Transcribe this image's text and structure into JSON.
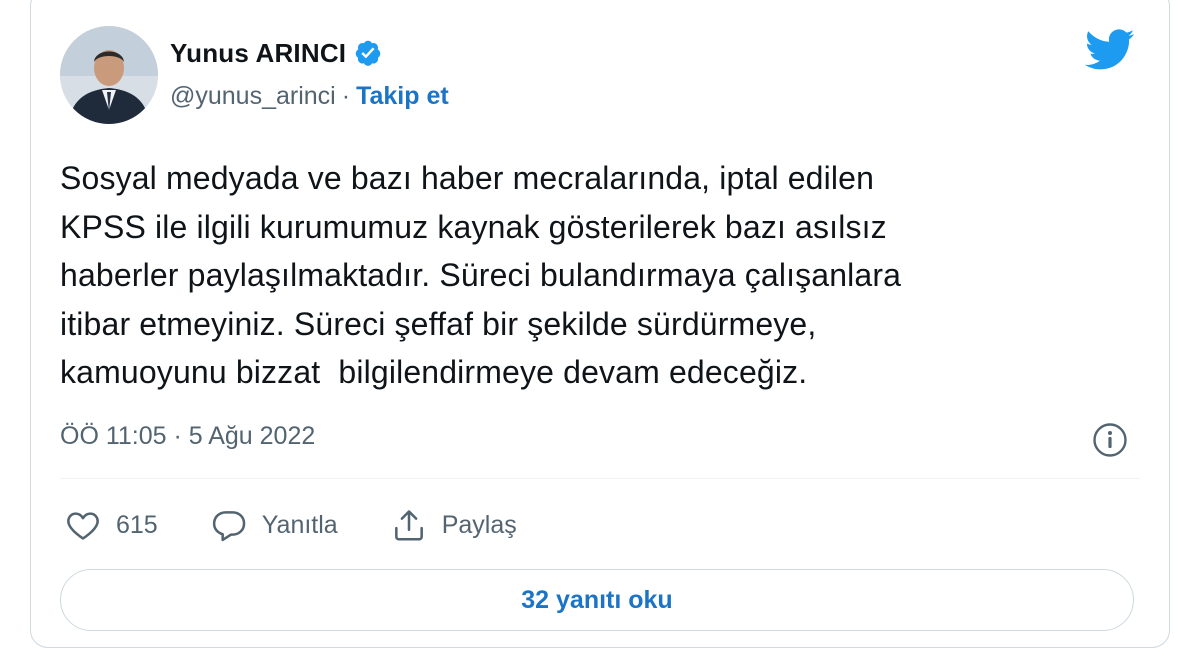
{
  "author": {
    "name": "Yunus ARINCI",
    "handle": "@yunus_arinci",
    "separator": "·",
    "follow_label": "Takip et",
    "verified": true
  },
  "tweet": {
    "text": "Sosyal medyada ve bazı haber mecralarında, iptal edilen\nKPSS ile ilgili kurumumuz kaynak gösterilerek bazı asılsız\nhaberler paylaşılmaktadır. Süreci bulandırmaya çalışanlara\nitibar etmeyiniz. Süreci şeffaf bir şekilde sürdürmeye,\nkamuoyunu bizzat  bilgilendirmeye devam edeceğiz.",
    "timestamp": "ÖÖ 11:05 · 5 Ağu 2022"
  },
  "actions": {
    "like_count": "615",
    "reply_label": "Yanıtla",
    "share_label": "Paylaş"
  },
  "read_replies_label": "32 yanıtı oku",
  "icons": {
    "brand": "twitter-bird-icon",
    "verified": "verified-badge-icon",
    "info": "info-icon",
    "like": "heart-icon",
    "reply": "reply-bubble-icon",
    "share": "share-icon"
  },
  "colors": {
    "brand_blue": "#1d9bf0",
    "link_blue": "#1b74c5",
    "text": "#0f1419",
    "muted": "#536471",
    "border": "#cfd9de"
  }
}
